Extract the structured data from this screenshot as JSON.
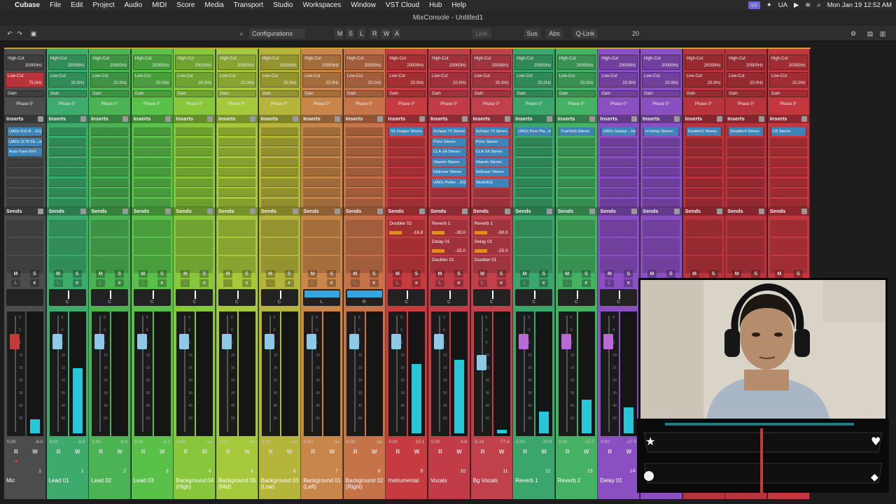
{
  "menubar": {
    "apple": "",
    "app": "Cubase",
    "items": [
      "File",
      "Edit",
      "Project",
      "Audio",
      "MIDI",
      "Score",
      "Media",
      "Transport",
      "Studio",
      "Workspaces",
      "Window",
      "VST Cloud",
      "Hub",
      "Help"
    ],
    "status_items": [
      "UA"
    ],
    "clock": "Mon Jan 19  12:52 AM"
  },
  "window": {
    "title": "MixConsole - Untitled1"
  },
  "toolbar": {
    "configurations": "Configurations",
    "m": "M",
    "s": "S",
    "l": "L",
    "r": "R",
    "w": "W",
    "a": "A",
    "link": "Link",
    "sus": "Sus",
    "abs": "Abs",
    "qlink": "Q-Link",
    "count": "20"
  },
  "labels": {
    "highcut": "High-Cut",
    "hc_freq": "20000Hz",
    "lowcut": "Low-Cut",
    "lc_freq": "20.0Hz",
    "gain": "Gain",
    "phase": "Phase 0°",
    "inserts": "Inserts",
    "sends": "Sends",
    "pan_c": "C",
    "read": "R",
    "write": "W"
  },
  "channels": [
    {
      "name": "Mic",
      "num": "1",
      "color": "#4c4c4c",
      "lowcut": "75.0Hz",
      "inserts": [
        "UADx 610-B ...EQ",
        "UADx 1176 FE...or",
        "Auto-Tune EFX"
      ],
      "sends": [],
      "fader": "0.00",
      "peak": "-8.0",
      "meter": 0.12,
      "pan": "",
      "knob": "#c23a3a"
    },
    {
      "name": "Lead 01",
      "num": "1",
      "color": "#3dab6b",
      "lowcut": "20.0Hz",
      "inserts": [],
      "sends": [],
      "fader": "0.00",
      "peak": "-8.0",
      "meter": 0.55,
      "pan": "C",
      "knob": "#8fc9e8"
    },
    {
      "name": "Lead 02",
      "num": "2",
      "color": "#4bb353",
      "lowcut": "20.0Hz",
      "inserts": [],
      "sends": [],
      "fader": "0.00",
      "peak": "-8.6",
      "meter": 0,
      "pan": "C",
      "knob": "#8fc9e8"
    },
    {
      "name": "Lead 03",
      "num": "3",
      "color": "#59c04a",
      "lowcut": "20.0Hz",
      "inserts": [],
      "sends": [],
      "fader": "0.00",
      "peak": "-9.3",
      "meter": 0,
      "pan": "C",
      "knob": "#8fc9e8"
    },
    {
      "name": "Background 04 (High)",
      "num": "4",
      "color": "#88c63c",
      "lowcut": "20.0Hz",
      "inserts": [],
      "sends": [],
      "fader": "0.00",
      "peak": "-oo",
      "meter": 0,
      "pan": "C",
      "knob": "#8fc9e8"
    },
    {
      "name": "Background 05 (Mid)",
      "num": "5",
      "color": "#a6c93b",
      "lowcut": "20.0Hz",
      "inserts": [],
      "sends": [],
      "fader": "0.00",
      "peak": "-oo",
      "meter": 0,
      "pan": "C",
      "knob": "#8fc9e8"
    },
    {
      "name": "Background 03 (Low)",
      "num": "6",
      "color": "#b4b53a",
      "lowcut": "20.0Hz",
      "inserts": [],
      "sends": [],
      "fader": "0.00",
      "peak": "-oo",
      "meter": 0,
      "pan": "C",
      "knob": "#8fc9e8"
    },
    {
      "name": "Background 01 (Left)",
      "num": "7",
      "color": "#c8864a",
      "lowcut": "20.0Hz",
      "inserts": [],
      "sends": [],
      "fader": "0.00",
      "peak": "-oo",
      "meter": 0,
      "pan": "L",
      "knob": "#8fc9e8"
    },
    {
      "name": "Background 02 (Right)",
      "num": "8",
      "color": "#c6734a",
      "lowcut": "20.0Hz",
      "inserts": [],
      "sends": [],
      "fader": "0.00",
      "peak": "-oo",
      "meter": 0,
      "pan": "R",
      "knob": "#8fc9e8"
    },
    {
      "name": "Instrumental",
      "num": "9",
      "color": "#c63b3f",
      "lowcut": "20.0Hz",
      "inserts": [
        "S1 Imager Stereo"
      ],
      "sends": [
        {
          "name": "Doubler 02",
          "val": "-16.8"
        }
      ],
      "fader": "0.00",
      "peak": "-10.1",
      "meter": 0.58,
      "pan": "C",
      "knob": "#8fc9e8"
    },
    {
      "name": "Vocals",
      "num": "10",
      "color": "#c23c48",
      "lowcut": "20.0Hz",
      "inserts": [
        "Scheps 73 Stereo",
        "PVox Stereo",
        "CLA-2A Stereo",
        "Vitamin Stereo",
        "DeEsser Stereo",
        "UADx Pultec ...EQ"
      ],
      "sends": [
        {
          "name": "Reverb 1",
          "val": "-30.0"
        },
        {
          "name": "Delay 01",
          "val": "-25.0"
        },
        {
          "name": "Doubler 01",
          "val": ""
        }
      ],
      "fader": "0.00",
      "peak": "-4.8",
      "meter": 0.62,
      "pan": "C",
      "knob": "#8fc9e8"
    },
    {
      "name": "Bg Vocals",
      "num": "11",
      "color": "#c0404c",
      "lowcut": "20.0Hz",
      "inserts": [
        "Scheps 73 Stereo",
        "PVox Stereo",
        "CLA-2A Stereo",
        "Vitamin Stereo",
        "DeEsser Stereo",
        "StudioEQ"
      ],
      "sends": [
        {
          "name": "Reverb 1",
          "val": "-30.0"
        },
        {
          "name": "Delay 01",
          "val": "-25.0"
        },
        {
          "name": "Doubler 01",
          "val": ""
        }
      ],
      "fader": "-5.14",
      "peak": "-77.4",
      "meter": 0.03,
      "pan": "C",
      "knob": "#8fc9e8"
    },
    {
      "name": "Reverb 1",
      "num": "12",
      "color": "#3ba66b",
      "lowcut": "20.0Hz",
      "inserts": [
        "UADx Pure Pla...ib"
      ],
      "sends": [],
      "fader": "0.00",
      "peak": "-29.9",
      "meter": 0.18,
      "pan": "C",
      "knob": "#b86bd6"
    },
    {
      "name": "Reverb 2",
      "num": "13",
      "color": "#45b163",
      "lowcut": "20.0Hz",
      "inserts": [
        "TrueVerb Stereo"
      ],
      "sends": [],
      "fader": "0.00",
      "peak": "-22.7",
      "meter": 0.28,
      "pan": "C",
      "knob": "#b86bd6"
    },
    {
      "name": "Delay 01",
      "num": "14",
      "color": "#8a4fc0",
      "lowcut": "20.0Hz",
      "inserts": [
        "UADx Galaxy ...ho"
      ],
      "sends": [],
      "fader": "0.00",
      "peak": "-27.0",
      "meter": 0.22,
      "pan": "C",
      "knob": "#b86bd6"
    },
    {
      "name": "",
      "num": "15",
      "color": "#8a4fc0",
      "lowcut": "20.0Hz",
      "inserts": [
        "H-Delay Stereo"
      ],
      "sends": [],
      "fader": "",
      "peak": "",
      "meter": 0,
      "pan": "",
      "knob": "#b86bd6"
    },
    {
      "name": "",
      "num": "16",
      "color": "#b8343c",
      "lowcut": "20.0Hz",
      "inserts": [
        "Doubler2 Stereo"
      ],
      "sends": [],
      "fader": "",
      "peak": "",
      "meter": 0,
      "pan": "",
      "knob": "#8fc9e8"
    },
    {
      "name": "",
      "num": "17",
      "color": "#b8343c",
      "lowcut": "20.0Hz",
      "inserts": [
        "Doubler4 Stereo"
      ],
      "sends": [],
      "fader": "",
      "peak": "",
      "meter": 0,
      "pan": "",
      "knob": "#8fc9e8"
    },
    {
      "name": "",
      "num": "18",
      "color": "#c4373f",
      "lowcut": "20.0Hz",
      "inserts": [
        "C6 Stereo"
      ],
      "sends": [],
      "fader": "",
      "peak": "",
      "meter": 0,
      "pan": "",
      "knob": "#8fc9e8"
    }
  ]
}
